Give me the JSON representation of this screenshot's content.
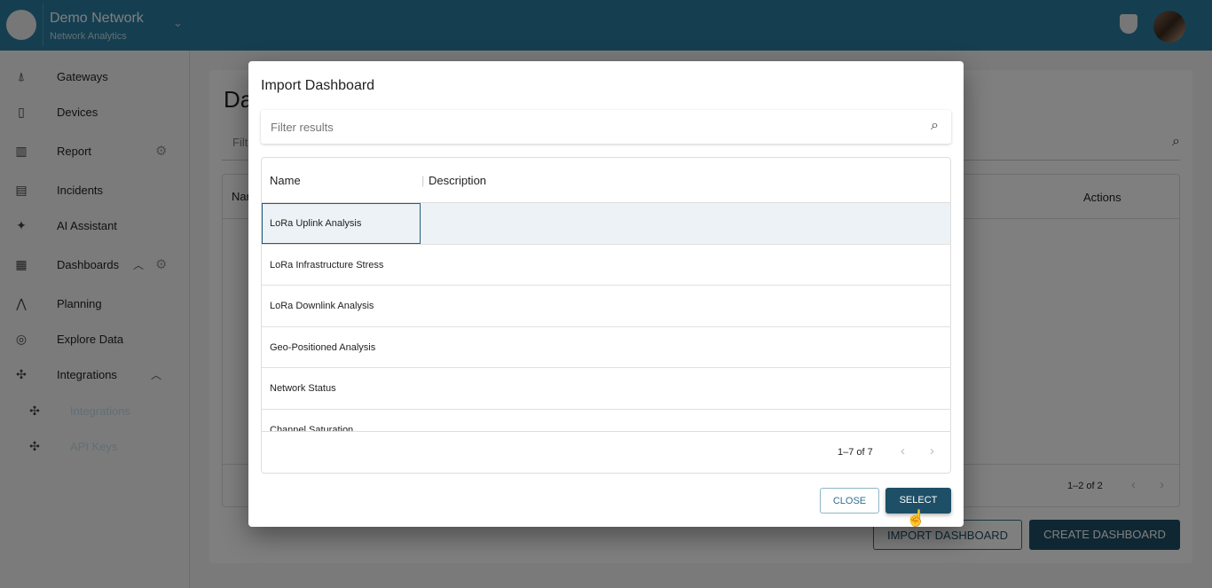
{
  "header": {
    "title": "Demo Network",
    "subtitle": "Network Analytics"
  },
  "sidebar": {
    "items": [
      {
        "label": "Gateways",
        "icon": "antenna-icon"
      },
      {
        "label": "Devices",
        "icon": "phone-icon"
      },
      {
        "label": "Report",
        "icon": "chart-icon"
      },
      {
        "label": "Incidents",
        "icon": "clipboard-icon"
      },
      {
        "label": "AI Assistant",
        "icon": "sparkle-icon"
      },
      {
        "label": "Dashboards",
        "icon": "dashboard-icon"
      },
      {
        "label": "Planning",
        "icon": "compass-draw-icon"
      },
      {
        "label": "Explore Data",
        "icon": "compass-icon"
      },
      {
        "label": "Integrations",
        "icon": "puzzle-icon"
      },
      {
        "label": "Integrations",
        "icon": "puzzle-icon"
      },
      {
        "label": "API Keys",
        "icon": "puzzle-icon"
      }
    ]
  },
  "page": {
    "title": "Da",
    "filter_placeholder": "Filt",
    "col_name": "Nar",
    "col_actions": "Actions",
    "pagination": "1–2 of 2",
    "import_label": "IMPORT DASHBOARD",
    "create_label": "CREATE DASHBOARD"
  },
  "modal": {
    "title": "Import Dashboard",
    "filter_placeholder": "Filter results",
    "columns": [
      "Name",
      "Description"
    ],
    "rows": [
      "LoRa Uplink Analysis",
      "LoRa Infrastructure Stress",
      "LoRa Downlink Analysis",
      "Geo-Positioned Analysis",
      "Network Status",
      "Channel Saturation"
    ],
    "pagination": "1–7 of 7",
    "close_label": "CLOSE",
    "select_label": "SELECT"
  },
  "colors": {
    "primary": "#1d4f66",
    "header": "#2a7ea3"
  }
}
